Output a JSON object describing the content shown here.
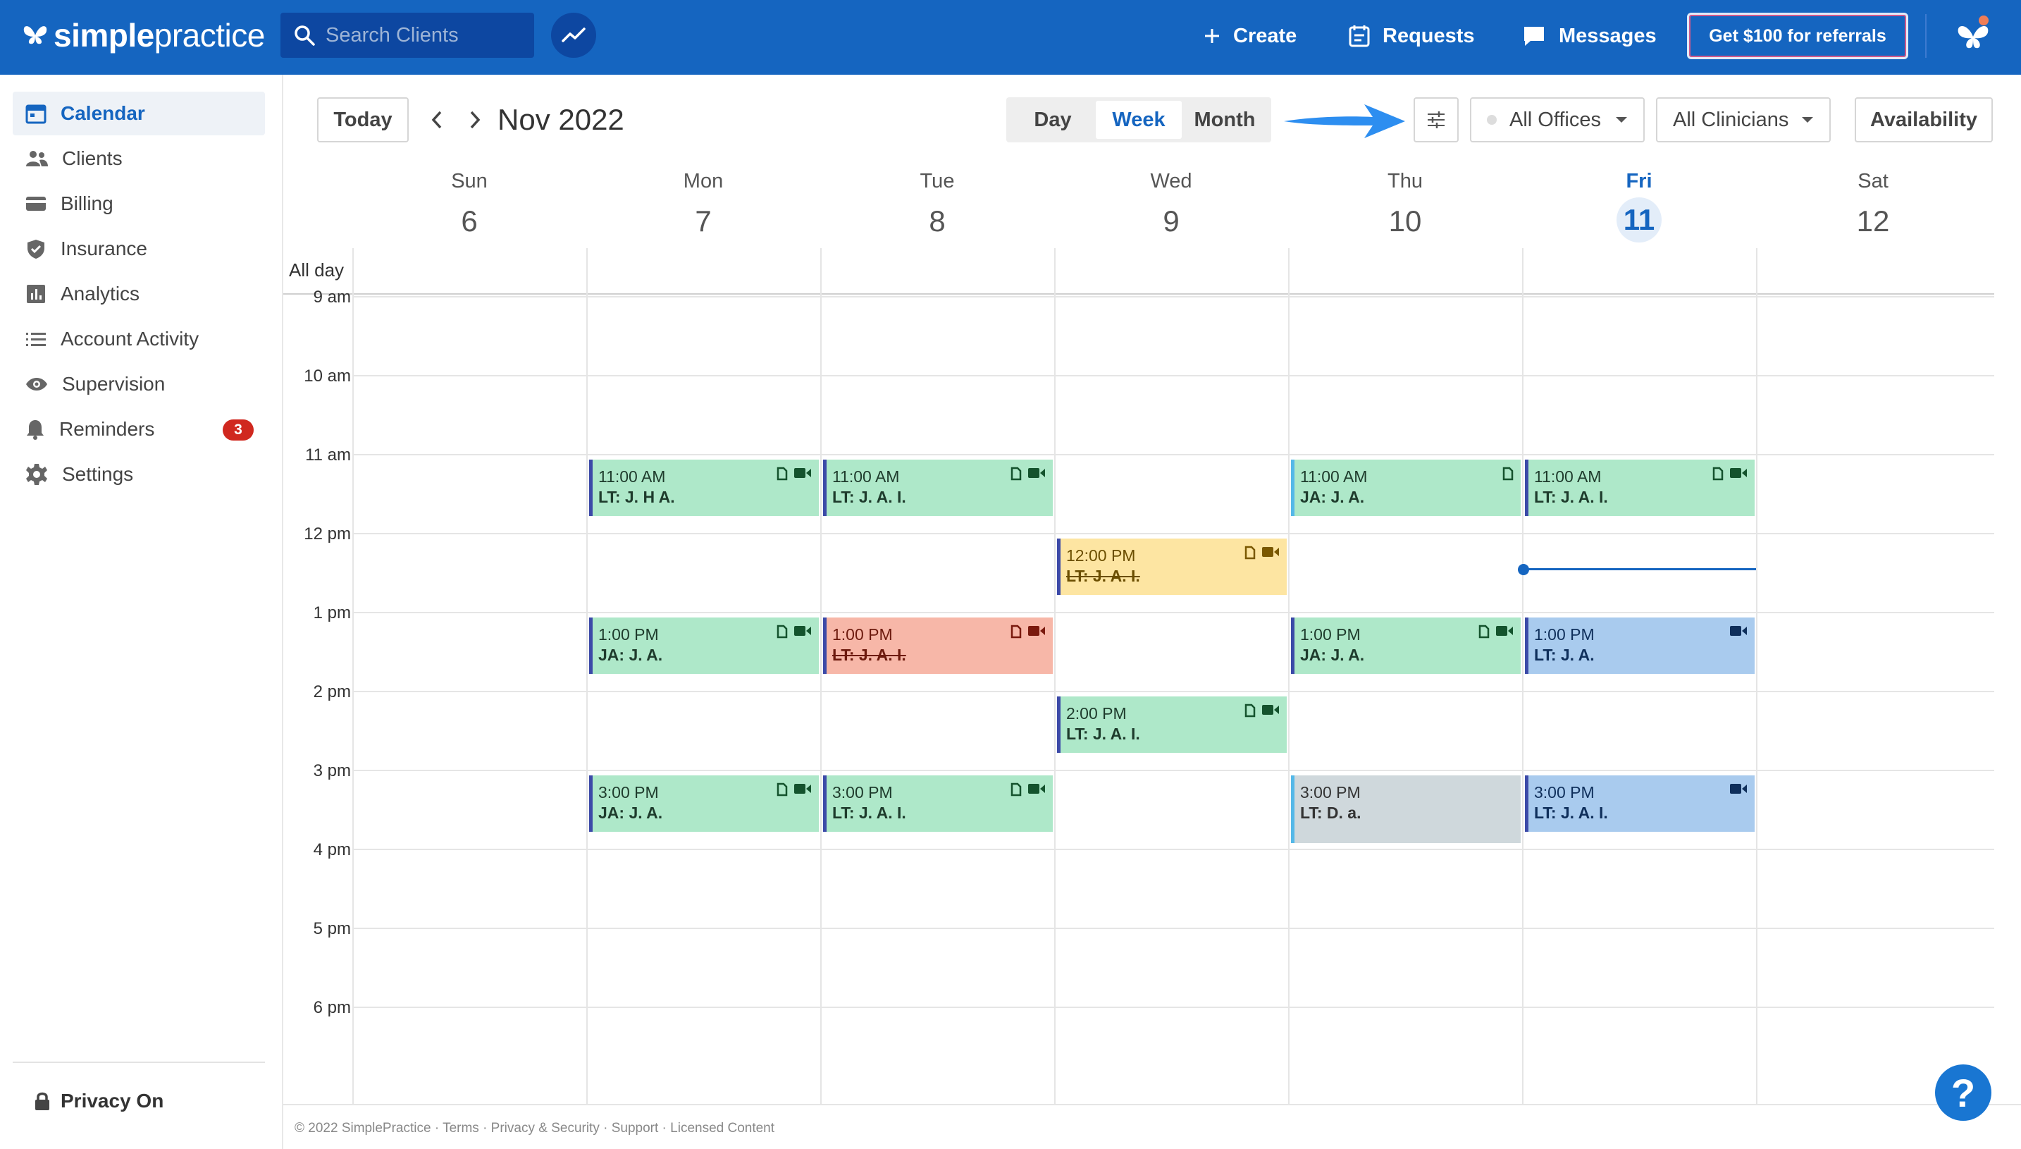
{
  "brand": {
    "logo_bold": "simple",
    "logo_light": "practice"
  },
  "header": {
    "search_placeholder": "Search Clients",
    "actions": [
      {
        "label": "Create",
        "icon": "plus-icon"
      },
      {
        "label": "Requests",
        "icon": "requests-icon"
      },
      {
        "label": "Messages",
        "icon": "messages-icon"
      }
    ],
    "referral_label": "Get $100 for referrals"
  },
  "sidebar": {
    "items": [
      {
        "label": "Calendar",
        "icon": "calendar-icon",
        "active": true
      },
      {
        "label": "Clients",
        "icon": "clients-icon"
      },
      {
        "label": "Billing",
        "icon": "billing-icon"
      },
      {
        "label": "Insurance",
        "icon": "insurance-icon"
      },
      {
        "label": "Analytics",
        "icon": "analytics-icon"
      },
      {
        "label": "Account Activity",
        "icon": "list-icon"
      },
      {
        "label": "Supervision",
        "icon": "eye-icon"
      },
      {
        "label": "Reminders",
        "icon": "bell-icon",
        "badge": "3"
      },
      {
        "label": "Settings",
        "icon": "gear-icon"
      }
    ],
    "privacy_label": "Privacy On"
  },
  "toolbar": {
    "today_label": "Today",
    "month_title": "Nov 2022",
    "views": [
      "Day",
      "Week",
      "Month"
    ],
    "active_view": "Week",
    "offices_label": "All Offices",
    "clinicians_label": "All Clinicians",
    "availability_label": "Availability"
  },
  "calendar": {
    "all_day_label": "All day",
    "days": [
      {
        "name": "Sun",
        "num": "6"
      },
      {
        "name": "Mon",
        "num": "7"
      },
      {
        "name": "Tue",
        "num": "8"
      },
      {
        "name": "Wed",
        "num": "9"
      },
      {
        "name": "Thu",
        "num": "10"
      },
      {
        "name": "Fri",
        "num": "11",
        "today": true
      },
      {
        "name": "Sat",
        "num": "12"
      }
    ],
    "hours": [
      "9 am",
      "10 am",
      "11 am",
      "12 pm",
      "1 pm",
      "2 pm",
      "3 pm",
      "4 pm",
      "5 pm",
      "6 pm"
    ],
    "events": [
      {
        "day": 1,
        "start": 11,
        "time": "11:00 AM",
        "name": "LT: J. H A.",
        "color": "green",
        "note": true,
        "video": true
      },
      {
        "day": 2,
        "start": 11,
        "time": "11:00 AM",
        "name": "LT: J. A. I.",
        "color": "green",
        "note": true,
        "video": true
      },
      {
        "day": 4,
        "start": 11,
        "time": "11:00 AM",
        "name": "JA: J. A.",
        "color": "green",
        "note": true,
        "video": false,
        "teal": true
      },
      {
        "day": 5,
        "start": 11,
        "time": "11:00 AM",
        "name": "LT: J. A. I.",
        "color": "green",
        "note": true,
        "video": true
      },
      {
        "day": 3,
        "start": 12,
        "time": "12:00 PM",
        "name": "LT: J. A. I.",
        "color": "yellow",
        "note": true,
        "video": true,
        "cancelled": true
      },
      {
        "day": 1,
        "start": 13,
        "time": "1:00 PM",
        "name": "JA: J. A.",
        "color": "green",
        "note": true,
        "video": true
      },
      {
        "day": 2,
        "start": 13,
        "time": "1:00 PM",
        "name": "LT: J. A. I.",
        "color": "red",
        "note": true,
        "video": true,
        "cancelled": true
      },
      {
        "day": 4,
        "start": 13,
        "time": "1:00 PM",
        "name": "JA: J. A.",
        "color": "green",
        "note": true,
        "video": true
      },
      {
        "day": 5,
        "start": 13,
        "time": "1:00 PM",
        "name": "LT: J. A.",
        "color": "blue",
        "note": false,
        "video": true
      },
      {
        "day": 3,
        "start": 14,
        "time": "2:00 PM",
        "name": "LT: J. A. I.",
        "color": "green",
        "note": true,
        "video": true
      },
      {
        "day": 1,
        "start": 15,
        "time": "3:00 PM",
        "name": "JA: J. A.",
        "color": "green",
        "note": true,
        "video": true
      },
      {
        "day": 2,
        "start": 15,
        "time": "3:00 PM",
        "name": "LT: J. A. I.",
        "color": "green",
        "note": true,
        "video": true
      },
      {
        "day": 4,
        "start": 15,
        "time": "3:00 PM",
        "name": "LT: D. a.",
        "color": "gray",
        "note": false,
        "video": false
      },
      {
        "day": 5,
        "start": 15,
        "time": "3:00 PM",
        "name": "LT: J. A. I.",
        "color": "blue",
        "note": false,
        "video": true
      }
    ]
  },
  "footer": {
    "text": "© 2022 SimplePractice · Terms · Privacy & Security · Support · Licensed Content"
  },
  "help_label": "?"
}
